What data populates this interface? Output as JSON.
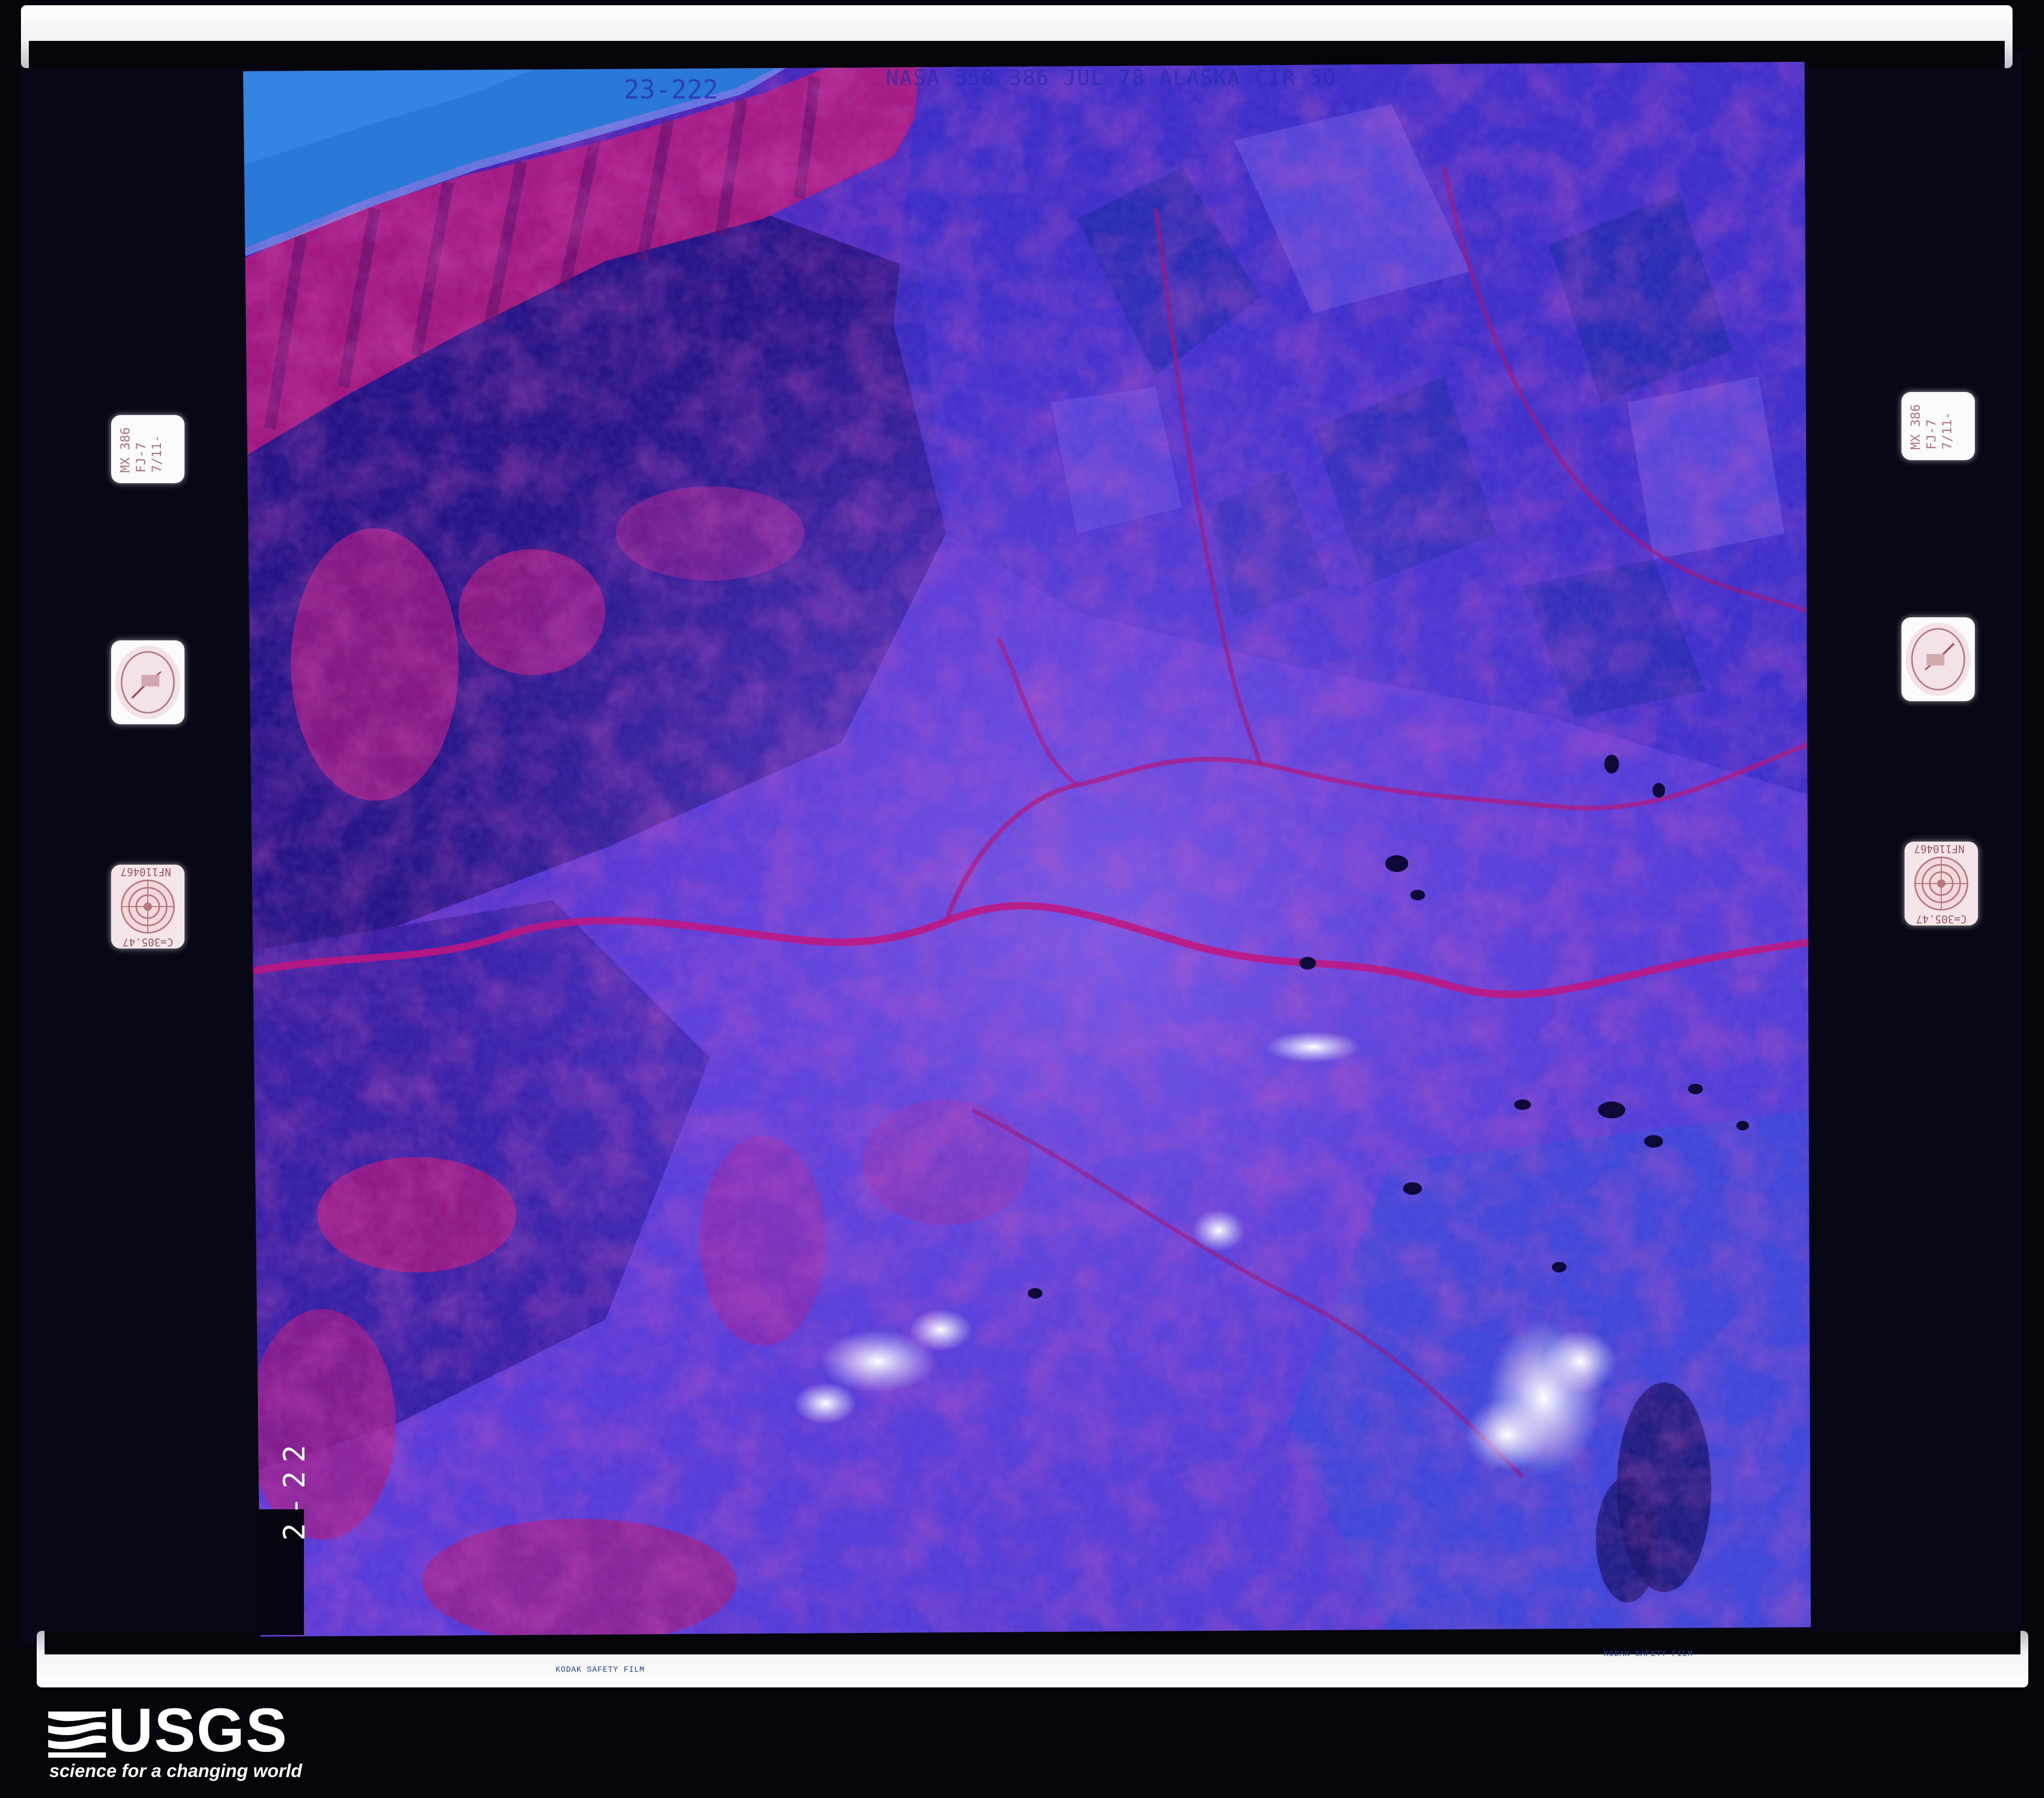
{
  "frame": {
    "roll_frame_label": "23-222",
    "mission_label": "NASA 350 386 JUL 78 ALASKA CIR 50",
    "side_frame_number": "2-22"
  },
  "film_edge": {
    "left_text": "KODAK SAFETY FILM",
    "right_text": "KODAK SAFETY FILM"
  },
  "aux_panels": {
    "note_text": "MX 386\nFJ-7\n7/11-",
    "lens_text_top": "NF110467",
    "lens_text_bottom": "C=305.47"
  },
  "photo": {
    "band": "color infrared",
    "colors": {
      "water": "#2a78d8",
      "vegetation": "#c0197a",
      "upland": "#4a3fd6",
      "dark_forest": "#1e0f7a",
      "cloud": "#f2f0ff"
    }
  },
  "logo": {
    "name": "USGS",
    "tagline": "science for a changing world"
  }
}
